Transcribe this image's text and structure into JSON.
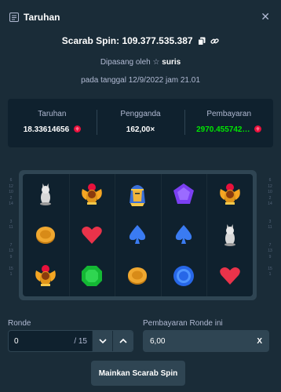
{
  "header": {
    "title": "Taruhan"
  },
  "bet": {
    "id_text": "Scarab Spin: 109.377.535.387",
    "placed_prefix": "Dipasang oleh",
    "user": "suris",
    "date": "pada tanggal 12/9/2022 jam 21.01"
  },
  "stats": {
    "bet_label": "Taruhan",
    "bet_value": "18.33614656",
    "multiplier_label": "Pengganda",
    "multiplier_value": "162,00×",
    "payout_label": "Pembayaran",
    "payout_value": "2970.455742…"
  },
  "side_numbers": {
    "left": [
      "6",
      "12",
      "10",
      "2",
      "14",
      "",
      "",
      "3",
      "11",
      "",
      "",
      "7",
      "13",
      "9",
      "",
      "15",
      "1"
    ],
    "right": [
      "6",
      "12",
      "10",
      "2",
      "14",
      "",
      "",
      "3",
      "11",
      "",
      "",
      "7",
      "13",
      "9",
      "",
      "15",
      "1"
    ]
  },
  "reels": [
    [
      "cat",
      "scarab",
      "pharaoh",
      "purple-gem",
      "scarab"
    ],
    [
      "coin",
      "red-heart",
      "blue-spade",
      "blue-spade",
      "cat"
    ],
    [
      "scarab",
      "green-gem",
      "coin",
      "blue-ring",
      "red-heart"
    ]
  ],
  "round": {
    "label": "Ronde",
    "value": "0",
    "total": "/ 15"
  },
  "round_payout": {
    "label": "Pembayaran Ronde ini",
    "value": "6,00",
    "clear": "X"
  },
  "play_button": "Mainkan Scarab Spin",
  "colors": {
    "background": "#1a2c38",
    "panel": "#0f212e",
    "accent_green": "#00e701",
    "gem_red": "#e9113c"
  }
}
